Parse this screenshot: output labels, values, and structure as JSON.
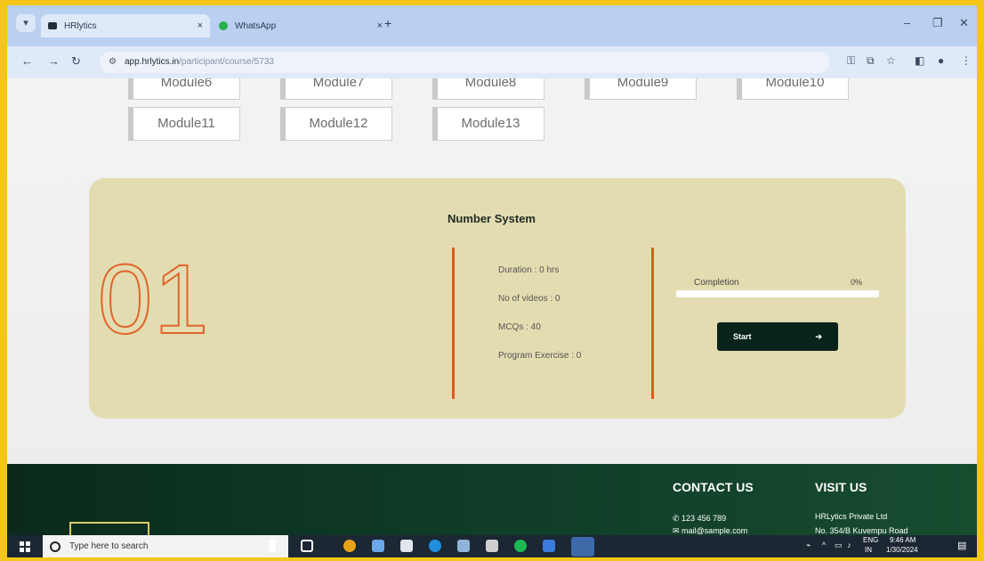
{
  "browser": {
    "tabs": [
      {
        "label": "HRlytics",
        "active": true
      },
      {
        "label": "WhatsApp",
        "active": false
      }
    ],
    "url_host": "app.hrlytics.in",
    "url_path": "/participant/course/5733",
    "new_tab": "+",
    "close": "×",
    "window_controls": [
      "–",
      "❐",
      "✕"
    ]
  },
  "modules": {
    "row1": [
      "Module6",
      "Module7",
      "Module8",
      "Module9",
      "Module10"
    ],
    "row2": [
      "Module11",
      "Module12",
      "Module13"
    ]
  },
  "card": {
    "number": "01",
    "title": "Number System",
    "stats": [
      "Duration : 0 hrs",
      "No of videos : 0",
      "MCQs : 40",
      "Program Exercise : 0"
    ],
    "completion_label": "Completion",
    "completion_pct": "0%",
    "progress_value": 0,
    "start_label": "Start",
    "start_arrow": "➔"
  },
  "footer": {
    "contact_heading": "CONTACT US",
    "phone": "123 456 789",
    "email": "mail@sample.com",
    "visit_heading": "VISIT US",
    "company": "HRLytics Private Ltd",
    "address": "No. 354/B Kuvempu Road"
  },
  "taskbar": {
    "search_placeholder": "Type here to search",
    "lang": "ENG",
    "region": "IN",
    "time": "9:46 AM",
    "date": "1/30/2024"
  },
  "colors": {
    "frame": "#f5c518",
    "card_bg": "#e3dcb1",
    "accent_orange": "#e05a1c",
    "start_btn": "#07231a",
    "footer": "#0f3b27"
  }
}
